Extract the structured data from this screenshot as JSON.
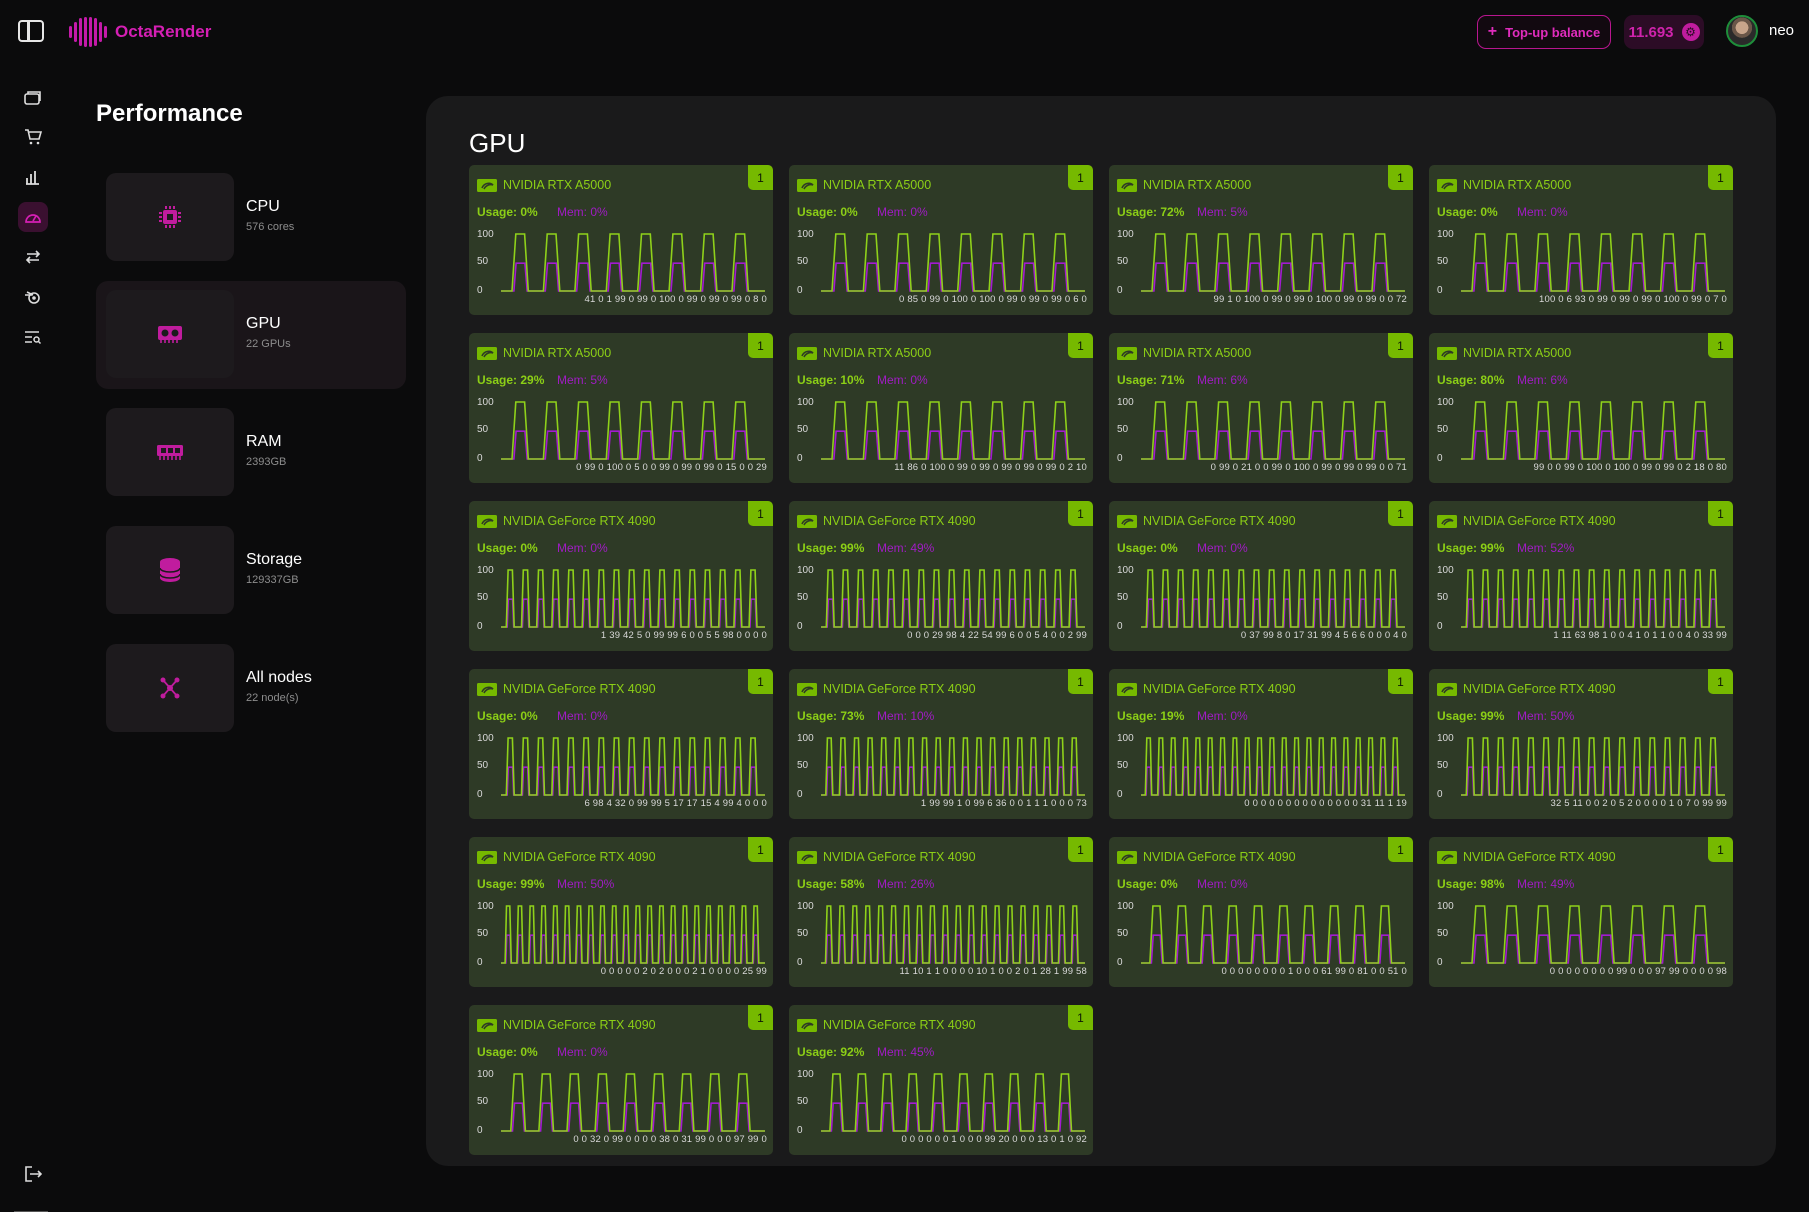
{
  "app": {
    "brand": "OctaRender",
    "topup_label": "Top-up balance",
    "balance": "11.693",
    "username": "neo"
  },
  "rail": [
    {
      "icon": "folder-stack-icon"
    },
    {
      "icon": "cart-icon"
    },
    {
      "icon": "bar-chart-icon"
    },
    {
      "icon": "speedometer-icon",
      "active": true
    },
    {
      "icon": "transfer-arrows-icon"
    },
    {
      "icon": "blender-icon"
    },
    {
      "icon": "search-list-icon"
    }
  ],
  "performance": {
    "title": "Performance",
    "categories": [
      {
        "name": "CPU",
        "sub": "576 cores",
        "icon": "cpu-chip-icon"
      },
      {
        "name": "GPU",
        "sub": "22 GPUs",
        "icon": "gpu-card-icon",
        "active": true
      },
      {
        "name": "RAM",
        "sub": "2393GB",
        "icon": "ram-module-icon"
      },
      {
        "name": "Storage",
        "sub": "129337GB",
        "icon": "database-icon"
      },
      {
        "name": "All nodes",
        "sub": "22 node(s)",
        "icon": "nodes-icon"
      }
    ]
  },
  "section_title": "GPU",
  "y_ticks": [
    "100",
    "50",
    "0"
  ],
  "colors": {
    "usage": "#8fd11a",
    "mem": "#a21bd0",
    "card_bg": "#2e3a26",
    "badge": "#76b900",
    "brand": "#d51fb4"
  },
  "gpus": [
    {
      "name": "NVIDIA RTX A5000",
      "badge": "1",
      "usage": "Usage: 0%",
      "mem": "Mem: 0%",
      "x_labels": "41 0 1 99 0 99 0 100 0 99 0 99 0 99 0 8 0",
      "peaks": 8
    },
    {
      "name": "NVIDIA RTX A5000",
      "badge": "1",
      "usage": "Usage: 0%",
      "mem": "Mem: 0%",
      "x_labels": "0 85 0 99 0 100 0 100 0 99 0 99 0 99 0 6 0",
      "peaks": 8
    },
    {
      "name": "NVIDIA RTX A5000",
      "badge": "1",
      "usage": "Usage: 72%",
      "mem": "Mem: 5%",
      "x_labels": "99 1 0 100 0 99 0 99 0 100 0 99 0 99 0 0 72",
      "peaks": 8
    },
    {
      "name": "NVIDIA RTX A5000",
      "badge": "1",
      "usage": "Usage: 0%",
      "mem": "Mem: 0%",
      "x_labels": "100 0 6 93 0 99 0 99 0 99 0 100 0 99 0 7 0",
      "peaks": 8
    },
    {
      "name": "NVIDIA RTX A5000",
      "badge": "1",
      "usage": "Usage: 29%",
      "mem": "Mem: 5%",
      "x_labels": "0 99 0 100 0 5 0 0 99 0 99 0 99 0 15 0 0 29",
      "peaks": 8
    },
    {
      "name": "NVIDIA RTX A5000",
      "badge": "1",
      "usage": "Usage: 10%",
      "mem": "Mem: 0%",
      "x_labels": "11 86 0 100 0 99 0 99 0 99 0 99 0 99 0 2 10",
      "peaks": 8
    },
    {
      "name": "NVIDIA RTX A5000",
      "badge": "1",
      "usage": "Usage: 71%",
      "mem": "Mem: 6%",
      "x_labels": "0 99 0 21 0 0 99 0 100 0 99 0 99 0 99 0 0 71",
      "peaks": 8
    },
    {
      "name": "NVIDIA RTX A5000",
      "badge": "1",
      "usage": "Usage: 80%",
      "mem": "Mem: 6%",
      "x_labels": "99 0 0 99 0 100 0 100 0 99 0 99 0 2 18 0 80",
      "peaks": 8
    },
    {
      "name": "NVIDIA GeForce RTX 4090",
      "badge": "1",
      "usage": "Usage: 0%",
      "mem": "Mem: 0%",
      "x_labels": "1 39 42 5 0 99 99 6 0 0 5 5 98 0 0 0 0",
      "peaks": 17
    },
    {
      "name": "NVIDIA GeForce RTX 4090",
      "badge": "1",
      "usage": "Usage: 99%",
      "mem": "Mem: 49%",
      "x_labels": "0 0 0 29 98 4 22 54 99 6 0 0 5 4 0 0 2 99",
      "peaks": 17
    },
    {
      "name": "NVIDIA GeForce RTX 4090",
      "badge": "1",
      "usage": "Usage: 0%",
      "mem": "Mem: 0%",
      "x_labels": "0 37 99 8 0 17 31 99 4 5 6 6 0 0 0 4 0",
      "peaks": 17
    },
    {
      "name": "NVIDIA GeForce RTX 4090",
      "badge": "1",
      "usage": "Usage: 99%",
      "mem": "Mem: 52%",
      "x_labels": "1 11 63 98 1 0 0 4 1 0 1 1 0 0 4 0 33 99",
      "peaks": 17
    },
    {
      "name": "NVIDIA GeForce RTX 4090",
      "badge": "1",
      "usage": "Usage: 0%",
      "mem": "Mem: 0%",
      "x_labels": "6 98 4 32 0 99 99 5 17 17 15 4 99 4 0 0 0",
      "peaks": 17
    },
    {
      "name": "NVIDIA GeForce RTX 4090",
      "badge": "1",
      "usage": "Usage: 73%",
      "mem": "Mem: 10%",
      "x_labels": "1 99 99 1 0 99 6 36 0 0 1 1 1 0 0 0 73",
      "peaks": 19
    },
    {
      "name": "NVIDIA GeForce RTX 4090",
      "badge": "1",
      "usage": "Usage: 19%",
      "mem": "Mem: 0%",
      "x_labels": "0 0 0 0 0 0 0 0 0 0 0 0 0 0 31 11 1 19",
      "peaks": 21
    },
    {
      "name": "NVIDIA GeForce RTX 4090",
      "badge": "1",
      "usage": "Usage: 99%",
      "mem": "Mem: 50%",
      "x_labels": "32 5 11 0 0 2 0 5 2 0 0 0 0 1 0 7 0 99 99",
      "peaks": 17
    },
    {
      "name": "NVIDIA GeForce RTX 4090",
      "badge": "1",
      "usage": "Usage: 99%",
      "mem": "Mem: 50%",
      "x_labels": "0 0 0 0 0 2 0 2 0 0 0 2 1 0 0 0 0 25 99",
      "peaks": 22
    },
    {
      "name": "NVIDIA GeForce RTX 4090",
      "badge": "1",
      "usage": "Usage: 58%",
      "mem": "Mem: 26%",
      "x_labels": "11 10 1 1 0 0 0 0 10 1 0 0 2 0 1 28 1 99 58",
      "peaks": 20
    },
    {
      "name": "NVIDIA GeForce RTX 4090",
      "badge": "1",
      "usage": "Usage: 0%",
      "mem": "Mem: 0%",
      "x_labels": "0 0 0 0 0 0 0 0 1 0 0 0 61 99 0 81 0 0 51 0",
      "peaks": 10
    },
    {
      "name": "NVIDIA GeForce RTX 4090",
      "badge": "1",
      "usage": "Usage: 98%",
      "mem": "Mem: 49%",
      "x_labels": "0 0 0 0 0 0 0 0 99 0 0 0 97 99 0 0 0 0 98",
      "peaks": 8
    },
    {
      "name": "NVIDIA GeForce RTX 4090",
      "badge": "1",
      "usage": "Usage: 0%",
      "mem": "Mem: 0%",
      "x_labels": "0 0 32 0 99 0 0 0 0 38 0 31 99 0 0 0 97 99 0",
      "peaks": 9
    },
    {
      "name": "NVIDIA GeForce RTX 4090",
      "badge": "1",
      "usage": "Usage: 92%",
      "mem": "Mem: 45%",
      "x_labels": "0 0 0 0 0 0 1 0 0 0 99 20 0 0 0 13 0 1 0 92",
      "peaks": 10
    }
  ]
}
